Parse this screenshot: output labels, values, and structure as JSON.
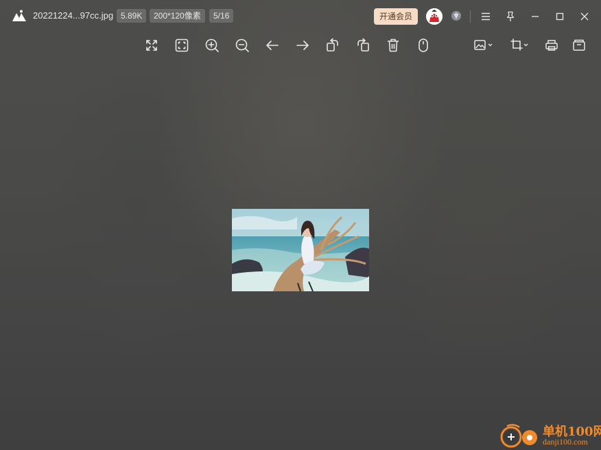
{
  "header": {
    "file_name": "20221224...97cc.jpg",
    "file_size": "5.89K",
    "dimensions": "200*120像素",
    "position": "5/16",
    "vip_label": "开通会员"
  },
  "toolbar": {
    "tools": [
      "fullscreen-icon",
      "fit-window-icon",
      "zoom-in-icon",
      "zoom-out-icon",
      "previous-icon",
      "next-icon",
      "rotate-left-icon",
      "rotate-right-icon",
      "delete-icon",
      "mouse-mode-icon",
      "image-edit-icon",
      "crop-icon",
      "print-icon",
      "open-folder-icon"
    ]
  },
  "watermark": {
    "site_name": "单机100网",
    "site_url": "danji100.com"
  },
  "colors": {
    "vip_bg": "#f6dcc6",
    "watermark": "#f08a2c"
  }
}
